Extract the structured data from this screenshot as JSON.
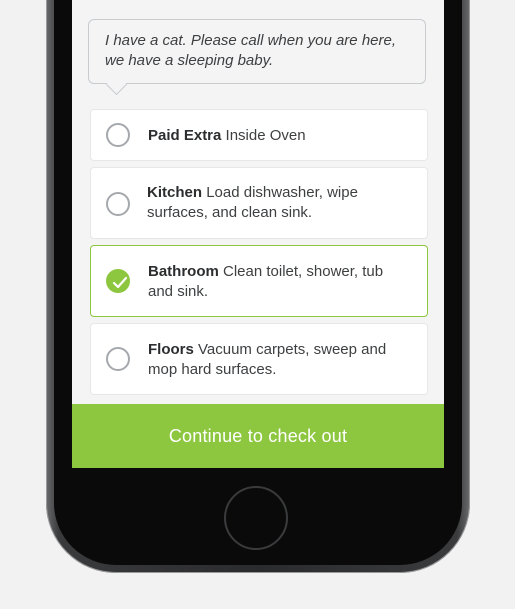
{
  "note": {
    "text_line1": "I have a cat. Please call when you are here,",
    "text_line2": "we have a sleeping baby."
  },
  "options": [
    {
      "title": "Paid Extra",
      "description": "Inside Oven",
      "selected": false
    },
    {
      "title": "Kitchen",
      "description": "Load dishwasher, wipe surfaces, and clean sink.",
      "selected": false
    },
    {
      "title": "Bathroom",
      "description": "Clean toilet, shower, tub and sink.",
      "selected": true
    },
    {
      "title": "Floors",
      "description": "Vacuum carpets, sweep and mop hard surfaces.",
      "selected": false
    }
  ],
  "cta": {
    "label": "Continue to check out"
  },
  "colors": {
    "accent": "#8dc63f",
    "background": "#f4f4f5",
    "text": "#3d3f41"
  },
  "icons": {
    "radio_selected": "checkmark-icon"
  }
}
